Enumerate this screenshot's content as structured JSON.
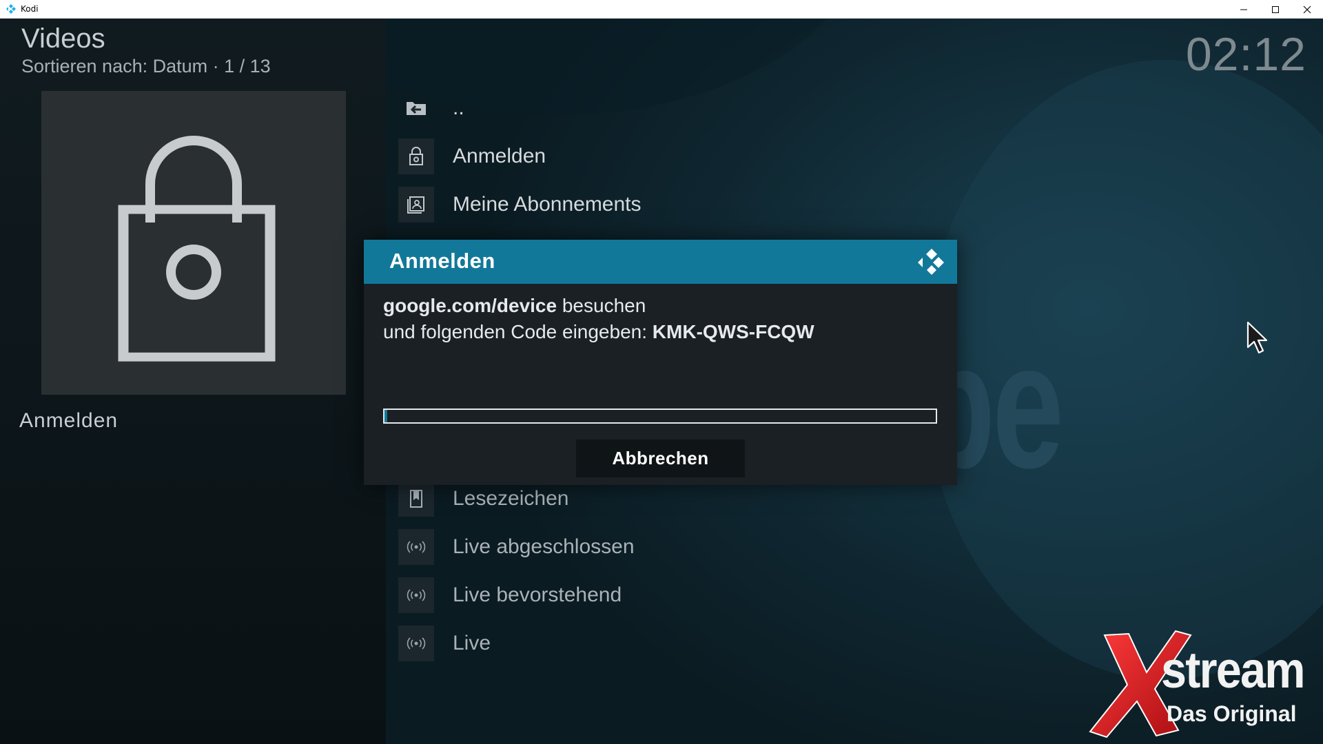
{
  "window": {
    "title": "Kodi"
  },
  "header": {
    "title": "Videos",
    "sort_info": "Sortieren nach: Datum  ·  1 / 13",
    "clock": "02:12"
  },
  "thumbnail": {
    "icon": "lock-icon",
    "label": "Anmelden"
  },
  "background": {
    "word_fragment": "be"
  },
  "list": {
    "items": [
      {
        "label": "..",
        "icon": "folder-back-icon"
      },
      {
        "label": "Anmelden",
        "icon": "lock-icon"
      },
      {
        "label": "Meine Abonnements",
        "icon": "subscriptions-icon"
      },
      {
        "label": "Lesezeichen",
        "icon": "bookmark-icon"
      },
      {
        "label": "Live abgeschlossen",
        "icon": "live-broadcast-icon"
      },
      {
        "label": "Live bevorstehend",
        "icon": "live-broadcast-icon"
      },
      {
        "label": "Live",
        "icon": "live-broadcast-icon"
      }
    ]
  },
  "dialog": {
    "title": "Anmelden",
    "url": "google.com/device",
    "line1_suffix": " besuchen",
    "line2_prefix": "und folgenden Code eingeben: ",
    "code": "KMK-QWS-FCQW",
    "progress": 0.005,
    "cancel_label": "Abbrechen"
  },
  "watermark": {
    "brand": "stream",
    "subtitle": "Das Original"
  },
  "colors": {
    "accent": "#12789a",
    "dialog_bg": "#1a2024",
    "watermark_x": "#d0161c"
  }
}
